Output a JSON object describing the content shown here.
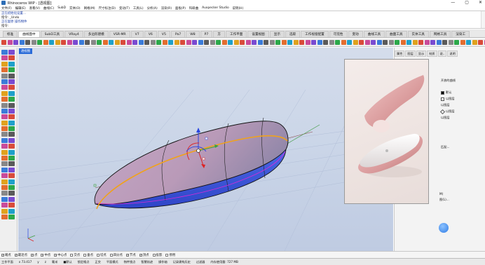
{
  "window": {
    "title": "Rhinoceros WIP - [透视图]",
    "controls": [
      "—",
      "▢",
      "✕"
    ]
  },
  "menu": [
    "文件(F)",
    "编辑(E)",
    "查看(V)",
    "曲线(C)",
    "SubD",
    "实体(O)",
    "网格(M)",
    "尺寸标注(D)",
    "变动(T)",
    "工具(L)",
    "分析(A)",
    "渲染(R)",
    "面板(P)",
    "科研曲",
    "Auxpecker Studio",
    "说明(H)"
  ],
  "command_history": [
    "正在初始化设置…",
    "指令: _Undo",
    "正在复原 操作物件",
    "指令:"
  ],
  "tabs": [
    "标准",
    "曲线面中",
    "SubD工具",
    "VRay4",
    "多边形建模",
    "VSR-MR",
    "V7",
    "V6",
    "V5",
    "Pa7",
    "W8",
    "P7",
    "方",
    "工作平面",
    "设置视图",
    "显示",
    "选取",
    "工作视窗配置",
    "可见性",
    "变动",
    "曲线工具",
    "曲面工具",
    "实体工具",
    "网格工具",
    "渲染工"
  ],
  "active_tab_index": 1,
  "viewport": {
    "label": "透视图"
  },
  "panel": {
    "tabs": [
      "属性",
      "图层",
      "显示",
      "材质",
      "说..",
      "说明"
    ],
    "rows": [
      "开放的曲线",
      "",
      "默认",
      "以图层",
      "以图层",
      "以图层",
      "以图层",
      "以图层",
      "",
      "",
      "",
      "",
      "",
      "",
      "",
      "",
      ""
    ],
    "extra": [
      "匹配...",
      "M)",
      "图(L)..."
    ]
  },
  "osnap": [
    {
      "label": "端点",
      "checked": true
    },
    {
      "label": "最近点",
      "checked": true
    },
    {
      "label": "点",
      "checked": true
    },
    {
      "label": "中点",
      "checked": true
    },
    {
      "label": "中心点",
      "checked": true
    },
    {
      "label": "交点",
      "checked": false
    },
    {
      "label": "垂点",
      "checked": false
    },
    {
      "label": "切点",
      "checked": false
    },
    {
      "label": "四分点",
      "checked": false
    },
    {
      "label": "节点",
      "checked": true
    },
    {
      "label": "顶点",
      "checked": true
    },
    {
      "label": "投影",
      "checked": false
    },
    {
      "label": "停用",
      "checked": false
    }
  ],
  "status": [
    "工作平面",
    "x 73.417",
    "y",
    "z",
    "毫米",
    "■默认",
    "锁定格点",
    "正交",
    "平面模式",
    "物件锁点",
    "智慧轨迹",
    "操作轴",
    "记录建构历史",
    "过滤器",
    "内存使用量: 727 MB"
  ],
  "colors": {
    "accent": "#2a6bd8",
    "surface_top": "#c8aeca",
    "surface_bottom": "#3b57d8",
    "curve": "#f0a21b"
  }
}
